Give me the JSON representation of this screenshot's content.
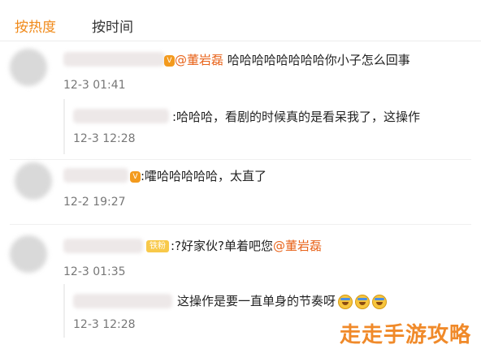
{
  "tabs": [
    {
      "label": "按热度"
    },
    {
      "label": "按时间"
    }
  ],
  "comments": [
    {
      "mention": "@董岩磊",
      "text": " 哈哈哈哈哈哈哈哈你小子怎么回事",
      "time": "12-3 01:41",
      "reply": {
        "text": ":哈哈哈，看剧的时候真的是看呆我了，这操作",
        "time": "12-3 12:28"
      }
    },
    {
      "text": ":嚯哈哈哈哈哈，太直了",
      "time": "12-2 19:27"
    },
    {
      "badge": "铁粉",
      "text": ":?好家伙?单着吧您",
      "mention": "@董岩磊",
      "time": "12-3 01:35",
      "reply": {
        "text": "这操作是要一直单身的节奏呀",
        "time": "12-3 12:28",
        "emojis": [
          "laugh-cry",
          "laugh-cry",
          "laugh-cry"
        ]
      }
    }
  ],
  "watermark": "走走手游攻略",
  "colors": {
    "accent": "#f08a1a",
    "mention": "#e8631a",
    "time": "#777777"
  }
}
